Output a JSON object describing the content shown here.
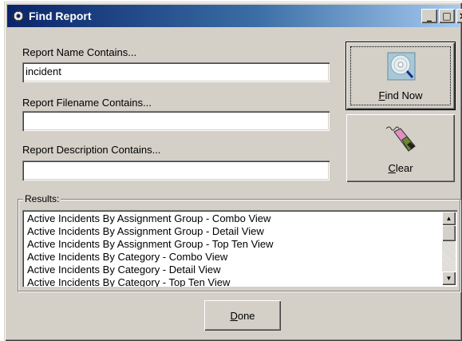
{
  "window": {
    "title": "Find Report"
  },
  "title_buttons": {
    "minimize": "_",
    "maximize": "□",
    "close": "×"
  },
  "form": {
    "name_label": "Report Name Contains...",
    "name_value": "incident",
    "filename_label": "Report Filename Contains...",
    "filename_value": "",
    "description_label": "Report Description Contains...",
    "description_value": ""
  },
  "buttons": {
    "find_now": {
      "accel": "F",
      "rest": "ind Now"
    },
    "clear": {
      "accel": "C",
      "rest": "lear"
    },
    "done": {
      "accel": "D",
      "rest": "one"
    }
  },
  "results": {
    "label": "Results:",
    "items": [
      "Active Incidents By Assignment Group - Combo View",
      "Active Incidents By Assignment Group - Detail View",
      "Active Incidents By Assignment Group - Top Ten View",
      "Active Incidents By Category - Combo View",
      "Active Incidents By Category - Detail View",
      "Active Incidents By Category - Top Ten View"
    ]
  },
  "scrollbar": {
    "up_glyph": "▲",
    "down_glyph": "▼"
  },
  "icons": {
    "title": "report-gear-icon",
    "find": "magnifier-disc-icon",
    "clear": "eraser-icon"
  },
  "colors": {
    "titlebar_start": "#0a246a",
    "titlebar_end": "#a6caf0",
    "face": "#d4d0c8"
  }
}
